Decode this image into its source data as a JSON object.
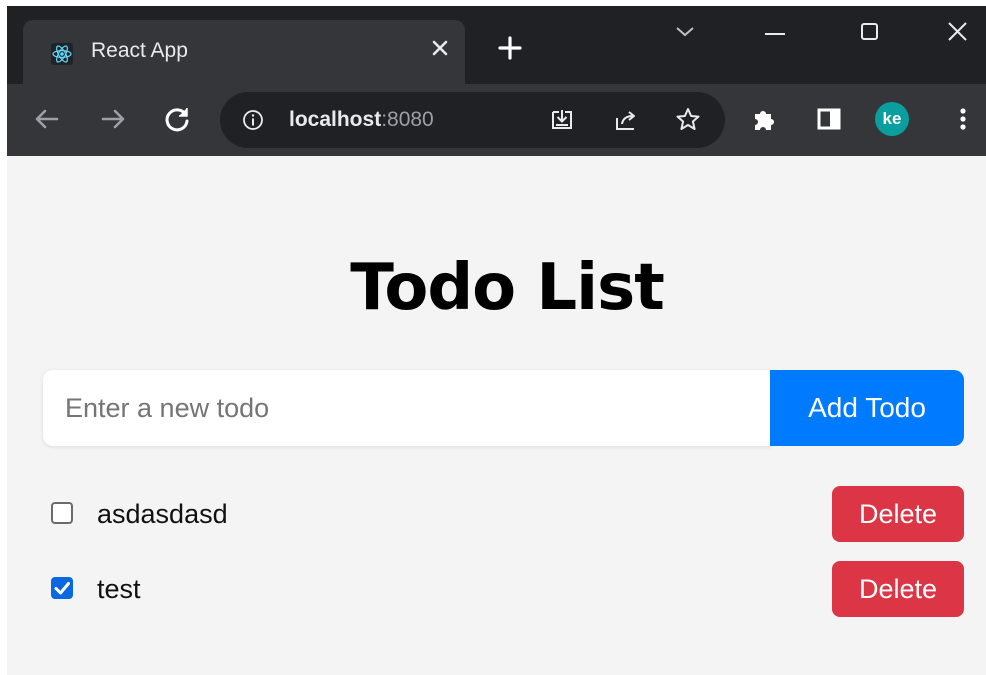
{
  "browser": {
    "tab": {
      "title": "React App",
      "favicon": "react-logo-icon"
    },
    "omnibox": {
      "host": "localhost",
      "port": ":8080"
    },
    "profile": {
      "initials": "ke",
      "color": "#0b9e9e"
    }
  },
  "page": {
    "title": "Todo List",
    "input": {
      "placeholder": "Enter a new todo",
      "value": ""
    },
    "add_button": "Add Todo",
    "todos": [
      {
        "text": "asdasdasd",
        "completed": false,
        "delete_label": "Delete"
      },
      {
        "text": "test",
        "completed": true,
        "delete_label": "Delete"
      }
    ]
  },
  "colors": {
    "primary": "#007bff",
    "danger": "#dc3545",
    "background": "#f4f4f4",
    "chrome_dark": "#202124",
    "chrome_toolbar": "#35363a"
  }
}
